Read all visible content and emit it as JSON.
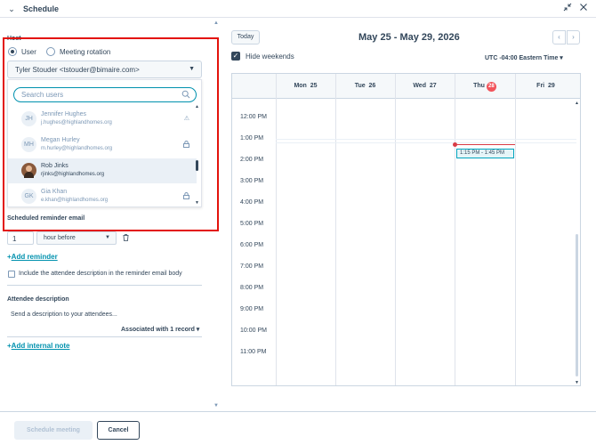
{
  "header": {
    "title": "Schedule",
    "collapse_icon": "chevron-down-icon",
    "minimize_icon": "minimize-icon",
    "close_icon": "close-icon"
  },
  "host": {
    "label": "Host",
    "options": [
      "User",
      "Meeting rotation"
    ],
    "selected_option": "User",
    "selected_user": "Tyler Stouder <tstouder@bimaire.com>"
  },
  "user_search": {
    "placeholder": "Search users",
    "users": [
      {
        "initials": "JH",
        "name": "Jennifer Hughes",
        "email": "j.hughes@highlandhomes.org",
        "status_icon": "warning-icon"
      },
      {
        "initials": "MH",
        "name": "Megan Hurley",
        "email": "m.hurley@highlandhomes.org",
        "status_icon": "lock-icon"
      },
      {
        "initials": "",
        "name": "Rob Jinks",
        "email": "rjinks@highlandhomes.org",
        "status_icon": "",
        "selected": true
      },
      {
        "initials": "GK",
        "name": "Gia Khan",
        "email": "e.khan@highlandhomes.org",
        "status_icon": "lock-icon"
      }
    ]
  },
  "reminder": {
    "title": "Scheduled reminder email",
    "amount": "1",
    "unit": "hour before",
    "add_label": "Add reminder",
    "include_label": "Include the attendee description in the reminder email body"
  },
  "attendee": {
    "title": "Attendee description",
    "text": "Send a description to your attendees...",
    "associated": "Associated with 1 record"
  },
  "internal_note": {
    "label": "Add internal note"
  },
  "calendar": {
    "today_label": "Today",
    "range": "May 25 - May 29, 2026",
    "hide_weekends": "Hide weekends",
    "timezone": "UTC -04:00 Eastern Time",
    "days": [
      {
        "name": "Mon",
        "num": "25",
        "today": false
      },
      {
        "name": "Tue",
        "num": "26",
        "today": false
      },
      {
        "name": "Wed",
        "num": "27",
        "today": false
      },
      {
        "name": "Thu",
        "num": "28",
        "today": true
      },
      {
        "name": "Fri",
        "num": "29",
        "today": false
      }
    ],
    "hours": [
      "12:00 PM",
      "1:00 PM",
      "2:00 PM",
      "3:00 PM",
      "4:00 PM",
      "5:00 PM",
      "6:00 PM",
      "7:00 PM",
      "8:00 PM",
      "9:00 PM",
      "10:00 PM",
      "11:00 PM"
    ],
    "event": "1:15 PM - 1:45 PM"
  },
  "footer": {
    "schedule_label": "Schedule meeting",
    "cancel_label": "Cancel"
  },
  "colors": {
    "accent": "#0091ae",
    "text": "#33475b",
    "highlight": "#e3120b",
    "today": "#f2545b",
    "event_border": "#00a4bd"
  }
}
